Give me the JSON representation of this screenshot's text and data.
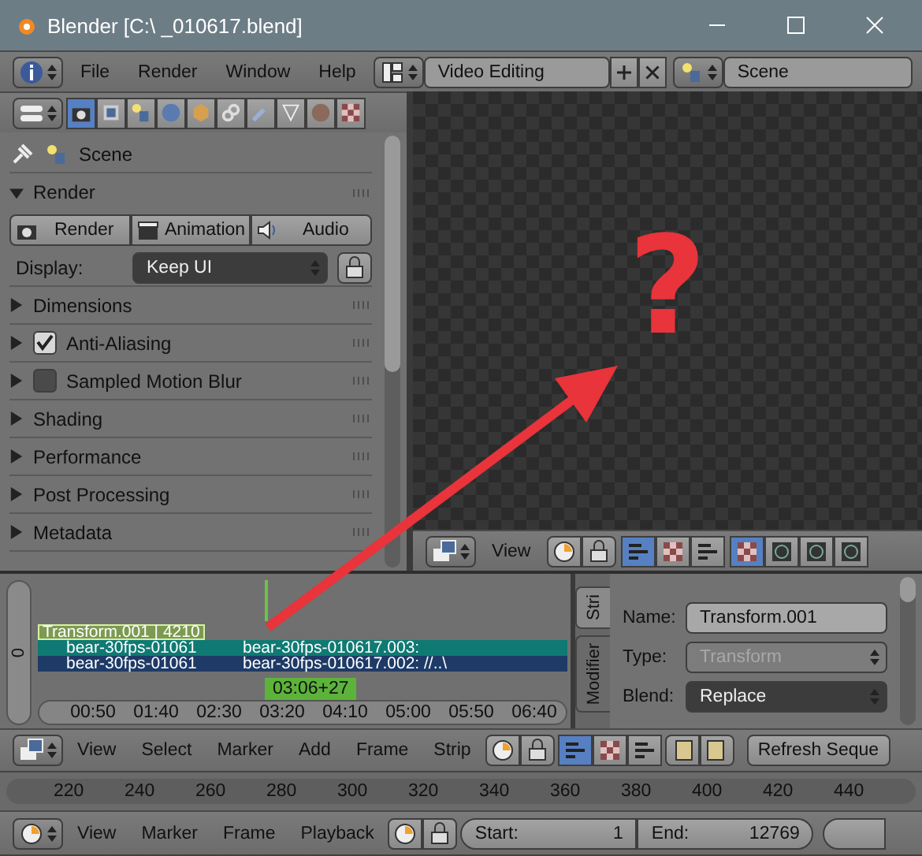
{
  "window": {
    "title": "Blender [C:\\ _010617.blend]"
  },
  "info_header": {
    "menus": [
      "File",
      "Render",
      "Window",
      "Help"
    ],
    "layout": "Video Editing",
    "scene": "Scene"
  },
  "properties": {
    "tabs": [
      {
        "selected": true
      },
      {
        "selected": false
      },
      {
        "selected": false
      },
      {
        "selected": false
      },
      {
        "selected": false
      },
      {
        "selected": false
      },
      {
        "selected": false
      },
      {
        "selected": false
      },
      {
        "selected": false
      },
      {
        "selected": false
      }
    ],
    "context": "Scene",
    "render_panel": {
      "title": "Render",
      "expanded": true,
      "buttons": [
        "Render",
        "Animation",
        "Audio"
      ],
      "display_label": "Display:",
      "display_value": "Keep UI"
    },
    "panels": [
      {
        "label": "Dimensions",
        "kind": "plain",
        "expanded": false
      },
      {
        "label": "Anti-Aliasing",
        "kind": "checkbox",
        "checked": true,
        "expanded": false
      },
      {
        "label": "Sampled Motion Blur",
        "kind": "checkbox",
        "checked": false,
        "expanded": false
      },
      {
        "label": "Shading",
        "kind": "plain",
        "expanded": false
      },
      {
        "label": "Performance",
        "kind": "plain",
        "expanded": false
      },
      {
        "label": "Post Processing",
        "kind": "plain",
        "expanded": false
      },
      {
        "label": "Metadata",
        "kind": "plain",
        "expanded": false
      }
    ]
  },
  "preview": {
    "overlay": "?",
    "view_menu": "View",
    "modes": [
      {
        "selected": true
      },
      {
        "selected": false
      },
      {
        "selected": false
      }
    ],
    "channels": [
      {
        "selected": true
      },
      {
        "selected": false
      },
      {
        "selected": false
      },
      {
        "selected": false
      }
    ]
  },
  "sequencer": {
    "channel": "0",
    "strips": [
      {
        "kind": "effect",
        "labels": [
          "Transform.001 | 4210"
        ]
      },
      {
        "kind": "movie",
        "color": "#0f7a73",
        "labels": [
          "bear-30fps-01061",
          "bear-30fps-010617.003:"
        ]
      },
      {
        "kind": "movie",
        "color": "#1e3a66",
        "labels": [
          "bear-30fps-01061",
          "bear-30fps-010617.002: //..\\"
        ]
      }
    ],
    "playhead": "03:06+27",
    "ticks": [
      "00:50",
      "01:40",
      "02:30",
      "03:20",
      "04:10",
      "05:00",
      "05:50",
      "06:40"
    ]
  },
  "strip_sidebar": {
    "tabs": [
      {
        "label": "Stri",
        "selected": true
      },
      {
        "label": "Modifier",
        "selected": false
      }
    ],
    "fields": [
      {
        "label": "Name:",
        "value": "Transform.001",
        "kind": "text"
      },
      {
        "label": "Type:",
        "value": "Transform",
        "kind": "select",
        "disabled": true
      },
      {
        "label": "Blend:",
        "value": "Replace",
        "kind": "select",
        "disabled": false
      }
    ]
  },
  "sequencer_header": {
    "menus": [
      "View",
      "Select",
      "Marker",
      "Add",
      "Frame",
      "Strip"
    ],
    "views": [
      {
        "selected": true
      },
      {
        "selected": false
      },
      {
        "selected": false
      }
    ],
    "refresh_button": "Refresh Seque"
  },
  "timeline": {
    "ticks": [
      "220",
      "240",
      "260",
      "280",
      "300",
      "320",
      "340",
      "360",
      "380",
      "400",
      "420",
      "440"
    ],
    "menus": [
      "View",
      "Marker",
      "Frame",
      "Playback"
    ],
    "start_label": "Start:",
    "start_value": "1",
    "end_label": "End:",
    "end_value": "12769"
  }
}
